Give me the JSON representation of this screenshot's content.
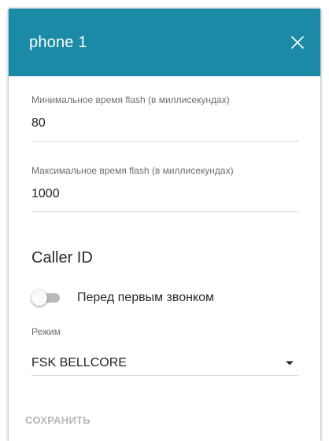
{
  "header": {
    "title": "phone 1",
    "close_icon": "close-icon",
    "color": "#1b8aa7"
  },
  "fields": {
    "min_flash": {
      "label": "Минимальное время flash (в миллисекундах)",
      "value": "80"
    },
    "max_flash": {
      "label": "Максимальное время flash (в миллисекундах)",
      "value": "1000"
    }
  },
  "caller_id": {
    "title": "Caller ID",
    "toggle": {
      "label": "Перед первым звонком",
      "enabled": false
    },
    "mode": {
      "label": "Режим",
      "selected": "FSK BELLCORE",
      "arrow_icon": "dropdown-arrow-icon"
    }
  },
  "actions": {
    "save_label": "СОХРАНИТЬ",
    "save_disabled_color": "#b7b7b7"
  }
}
